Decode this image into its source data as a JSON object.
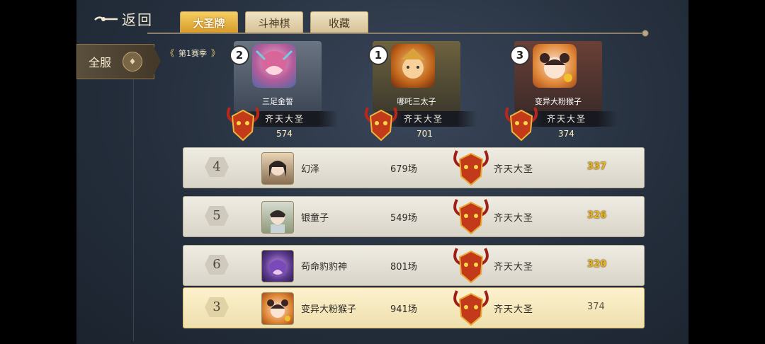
{
  "header": {
    "back_label": "返回",
    "tabs": [
      {
        "label": "大圣牌",
        "active": true
      },
      {
        "label": "斗神棋",
        "active": false
      },
      {
        "label": "收藏",
        "active": false
      }
    ]
  },
  "server": {
    "label": "全服"
  },
  "season": {
    "label": "第1赛季",
    "prev_icon": "double-chevron-left-icon",
    "next_icon": "double-chevron-right-icon"
  },
  "podium": [
    {
      "place": "2",
      "name": "三足金誓",
      "title": "齐天大圣",
      "score": "574",
      "accent": "#8d97a6"
    },
    {
      "place": "1",
      "name": "哪吒三太子",
      "title": "齐天大圣",
      "score": "701",
      "accent": "#a58b48"
    },
    {
      "place": "3",
      "name": "变异大粉猴子",
      "title": "齐天大圣",
      "score": "374",
      "accent": "#7a4b3c"
    }
  ],
  "rows": [
    {
      "rank": "4",
      "name": "幻泽",
      "count": "679场",
      "title": "齐天大圣",
      "score": "337",
      "mine": false
    },
    {
      "rank": "5",
      "name": "银童子",
      "count": "549场",
      "title": "齐天大圣",
      "score": "326",
      "mine": false
    },
    {
      "rank": "6",
      "name": "苟命豹豹神",
      "count": "801场",
      "title": "齐天大圣",
      "score": "320",
      "mine": false
    },
    {
      "rank": "3",
      "name": "变异大粉猴子",
      "count": "941场",
      "title": "齐天大圣",
      "score": "374",
      "mine": true
    }
  ],
  "colors": {
    "accent_gold": "#e6b820",
    "tab_active": "#e2a532",
    "bg": "#252f3d"
  }
}
